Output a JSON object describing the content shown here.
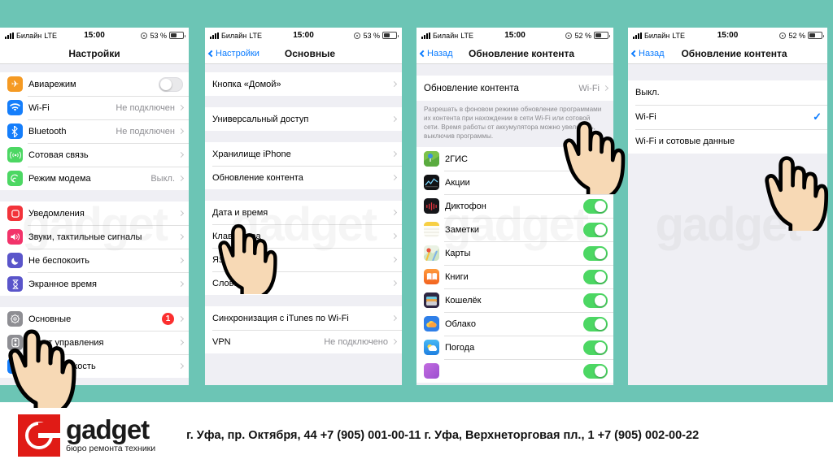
{
  "background_color": "#6cc5b5",
  "statusbar": {
    "carrier": "Билайн",
    "network": "LTE",
    "time": "15:00",
    "battery_53": "53 %",
    "battery_52": "52 %"
  },
  "screen1": {
    "title": "Настройки",
    "groups": [
      {
        "rows": [
          {
            "label": "Авиарежим",
            "icon": "airplane-icon",
            "icon_color": "#f59a23",
            "control": "toggle",
            "toggle_on": false
          },
          {
            "label": "Wi-Fi",
            "icon": "wifi-icon",
            "icon_color": "#157efb",
            "value": "Не подключен",
            "control": "chevron"
          },
          {
            "label": "Bluetooth",
            "icon": "bluetooth-icon",
            "icon_color": "#157efb",
            "value": "Не подключен",
            "control": "chevron"
          },
          {
            "label": "Сотовая связь",
            "icon": "cellular-icon",
            "icon_color": "#4cd763",
            "value": "",
            "control": "chevron"
          },
          {
            "label": "Режим модема",
            "icon": "hotspot-icon",
            "icon_color": "#4cd763",
            "value": "Выкл.",
            "control": "chevron"
          }
        ]
      },
      {
        "rows": [
          {
            "label": "Уведомления",
            "icon": "notifications-icon",
            "icon_color": "#f2333a",
            "control": "chevron"
          },
          {
            "label": "Звуки, тактильные сигналы",
            "icon": "sounds-icon",
            "icon_color": "#f2336a",
            "control": "chevron"
          },
          {
            "label": "Не беспокоить",
            "icon": "moon-icon",
            "icon_color": "#5a55ca",
            "control": "chevron"
          },
          {
            "label": "Экранное время",
            "icon": "screentime-icon",
            "icon_color": "#5a55ca",
            "control": "chevron"
          }
        ]
      },
      {
        "rows": [
          {
            "label": "Основные",
            "icon": "gear-icon",
            "icon_color": "#8e8e93",
            "badge": "1",
            "control": "chevron"
          },
          {
            "label": "Пункт управления",
            "icon": "control-center-icon",
            "icon_color": "#8e8e93",
            "control": "chevron"
          },
          {
            "label": "Экран и яркость",
            "icon": "display-brightness-icon",
            "icon_color": "#157efb",
            "control": "chevron"
          }
        ]
      }
    ]
  },
  "screen2": {
    "back_label": "Настройки",
    "title": "Основные",
    "groups": [
      {
        "rows": [
          {
            "label": "Кнопка «Домой»",
            "control": "chevron"
          }
        ]
      },
      {
        "rows": [
          {
            "label": "Универсальный доступ",
            "control": "chevron"
          }
        ]
      },
      {
        "rows": [
          {
            "label": "Хранилище iPhone",
            "control": "chevron"
          },
          {
            "label": "Обновление контента",
            "control": "chevron"
          }
        ]
      },
      {
        "rows": [
          {
            "label": "Дата и время",
            "control": "chevron"
          },
          {
            "label": "Клавиатура",
            "control": "chevron"
          },
          {
            "label": "Язык и регион",
            "control": "chevron"
          },
          {
            "label": "Словарь",
            "control": "chevron"
          }
        ]
      },
      {
        "rows": [
          {
            "label": "Синхронизация с iTunes по Wi-Fi",
            "control": "chevron"
          },
          {
            "label": "VPN",
            "value": "Не подключено",
            "control": "chevron"
          }
        ]
      }
    ]
  },
  "screen3": {
    "back_label": "Назад",
    "title": "Обновление контента",
    "main_row": {
      "label": "Обновление контента",
      "value": "Wi-Fi"
    },
    "footnote": "Разрешать в фоновом режиме обновление программами их контента при нахождении в сети Wi-Fi или сотовой сети. Время работы от аккумулятора можно увеличить, выключив программы.",
    "apps": [
      {
        "label": "2ГИС",
        "icon": "2gis-app-icon",
        "icon_color": "#7bc043",
        "on": true
      },
      {
        "label": "Акции",
        "icon": "stocks-app-icon",
        "icon_color": "#1c1c1e",
        "on": true
      },
      {
        "label": "Диктофон",
        "icon": "voice-memos-app-icon",
        "icon_color": "#1c1c1e",
        "on": true
      },
      {
        "label": "Заметки",
        "icon": "notes-app-icon",
        "icon_color": "#f5d33f",
        "on": true
      },
      {
        "label": "Карты",
        "icon": "maps-app-icon",
        "icon_color": "#e8f0e0",
        "on": true
      },
      {
        "label": "Книги",
        "icon": "books-app-icon",
        "icon_color": "#f2762a",
        "on": true
      },
      {
        "label": "Кошелёк",
        "icon": "wallet-app-icon",
        "icon_color": "#3a2f52",
        "on": true
      },
      {
        "label": "Облако",
        "icon": "cloud-app-icon",
        "icon_color": "#2f7fe8",
        "on": true
      },
      {
        "label": "Погода",
        "icon": "weather-app-icon",
        "icon_color": "#2f9fe8",
        "on": true
      },
      {
        "label": "",
        "icon": "partial-app-icon",
        "icon_color": "#b45fd6",
        "on": true
      }
    ]
  },
  "screen4": {
    "back_label": "Назад",
    "title": "Обновление контента",
    "options": [
      {
        "label": "Выкл.",
        "selected": false
      },
      {
        "label": "Wi-Fi",
        "selected": true
      },
      {
        "label": "Wi-Fi и сотовые данные",
        "selected": false
      }
    ],
    "check_glyph": "✓"
  },
  "watermark_text": "gadget",
  "footer": {
    "logo_name": "gadget",
    "logo_tagline": "бюро ремонта техники",
    "address": "г. Уфа, пр. Октября, 44   +7 (905) 001-00-11 г. Уфа, Верхнеторговая пл., 1  +7 (905) 002-00-22"
  }
}
